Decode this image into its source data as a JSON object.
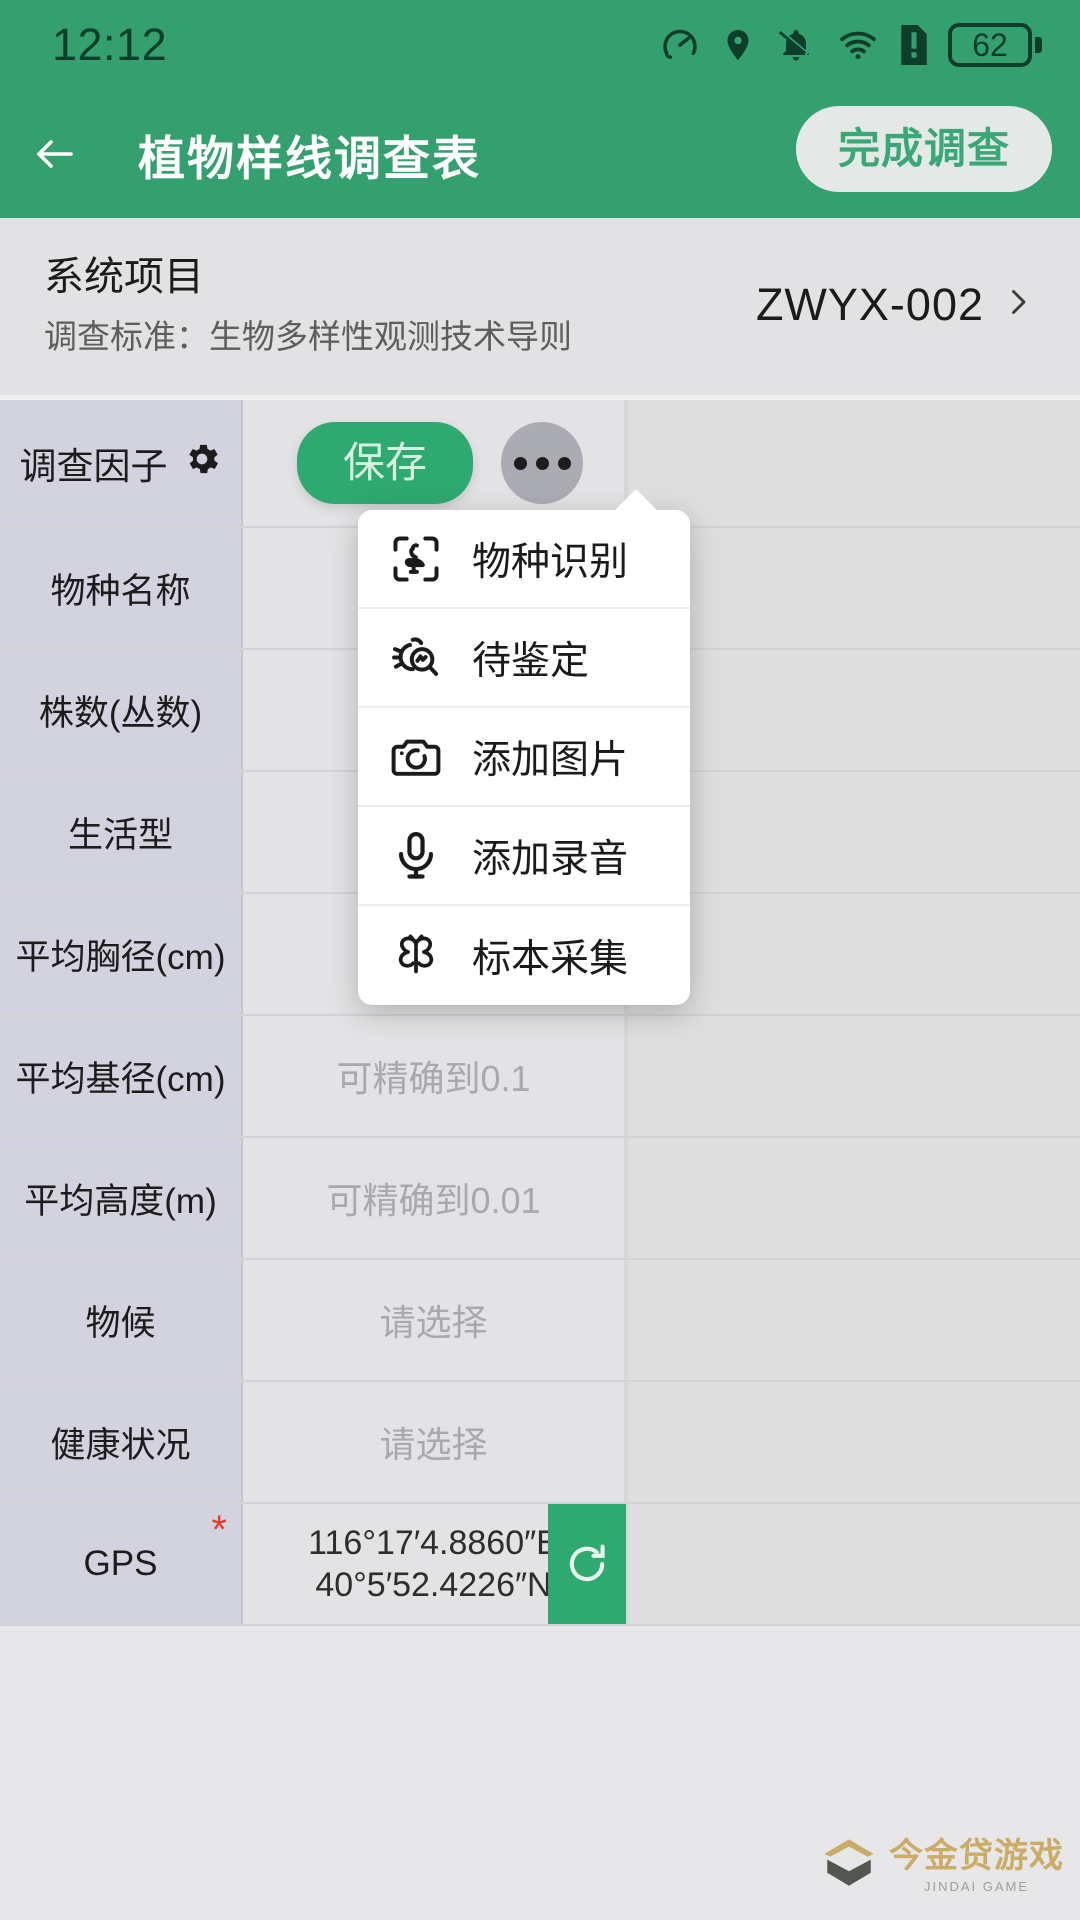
{
  "statusbar": {
    "time": "12:12",
    "battery_level": "62",
    "icons": [
      "data-saver-icon",
      "location-icon",
      "notifications-off-icon",
      "wifi-icon",
      "sim-alert-icon",
      "battery-icon"
    ]
  },
  "appbar": {
    "back_label": "←",
    "title": "植物样线调查表",
    "finish_label": "完成调查"
  },
  "project": {
    "name": "系统项目",
    "standard": "调查标准：生物多样性观测技术导则",
    "code": "ZWYX-002",
    "chevron": "›"
  },
  "table": {
    "header": {
      "label": "调查因子",
      "gear_icon": "gear-icon",
      "save_label": "保存",
      "more_label": "more-icon"
    },
    "rows": [
      {
        "label": "物种名称",
        "value": "",
        "placeholder": "",
        "required": false
      },
      {
        "label": "株数(丛数)",
        "value": "",
        "placeholder": "",
        "required": false
      },
      {
        "label": "生活型",
        "value": "",
        "placeholder": "",
        "required": false
      },
      {
        "label": "平均胸径(cm)",
        "value": "",
        "placeholder": "",
        "required": false
      },
      {
        "label": "平均基径(cm)",
        "value": "可精确到0.1",
        "placeholder": "可精确到0.1",
        "required": false
      },
      {
        "label": "平均高度(m)",
        "value": "可精确到0.01",
        "placeholder": "可精确到0.01",
        "required": false
      },
      {
        "label": "物候",
        "value": "请选择",
        "placeholder": "请选择",
        "required": false
      },
      {
        "label": "健康状况",
        "value": "请选择",
        "placeholder": "请选择",
        "required": false
      }
    ],
    "gps_row": {
      "label": "GPS",
      "required_mark": "*",
      "line1": "116°17′4.8860″E",
      "line2": "40°5′52.4226″N",
      "refresh_icon": "refresh-icon"
    }
  },
  "menu": {
    "items": [
      {
        "label": "物种识别",
        "icon": "species-scan-icon"
      },
      {
        "label": "待鉴定",
        "icon": "identify-pending-icon"
      },
      {
        "label": "添加图片",
        "icon": "camera-icon"
      },
      {
        "label": "添加录音",
        "icon": "microphone-icon"
      },
      {
        "label": "标本采集",
        "icon": "butterfly-icon"
      }
    ]
  },
  "watermark": {
    "main": "今金贷游戏",
    "sub": "JINDAI GAME"
  },
  "colors": {
    "brand_green": "#34a070",
    "save_green": "#2ea96f",
    "label_bg": "#d2d3de",
    "value_bg": "#e3e3e5",
    "required_red": "#e8372d"
  }
}
